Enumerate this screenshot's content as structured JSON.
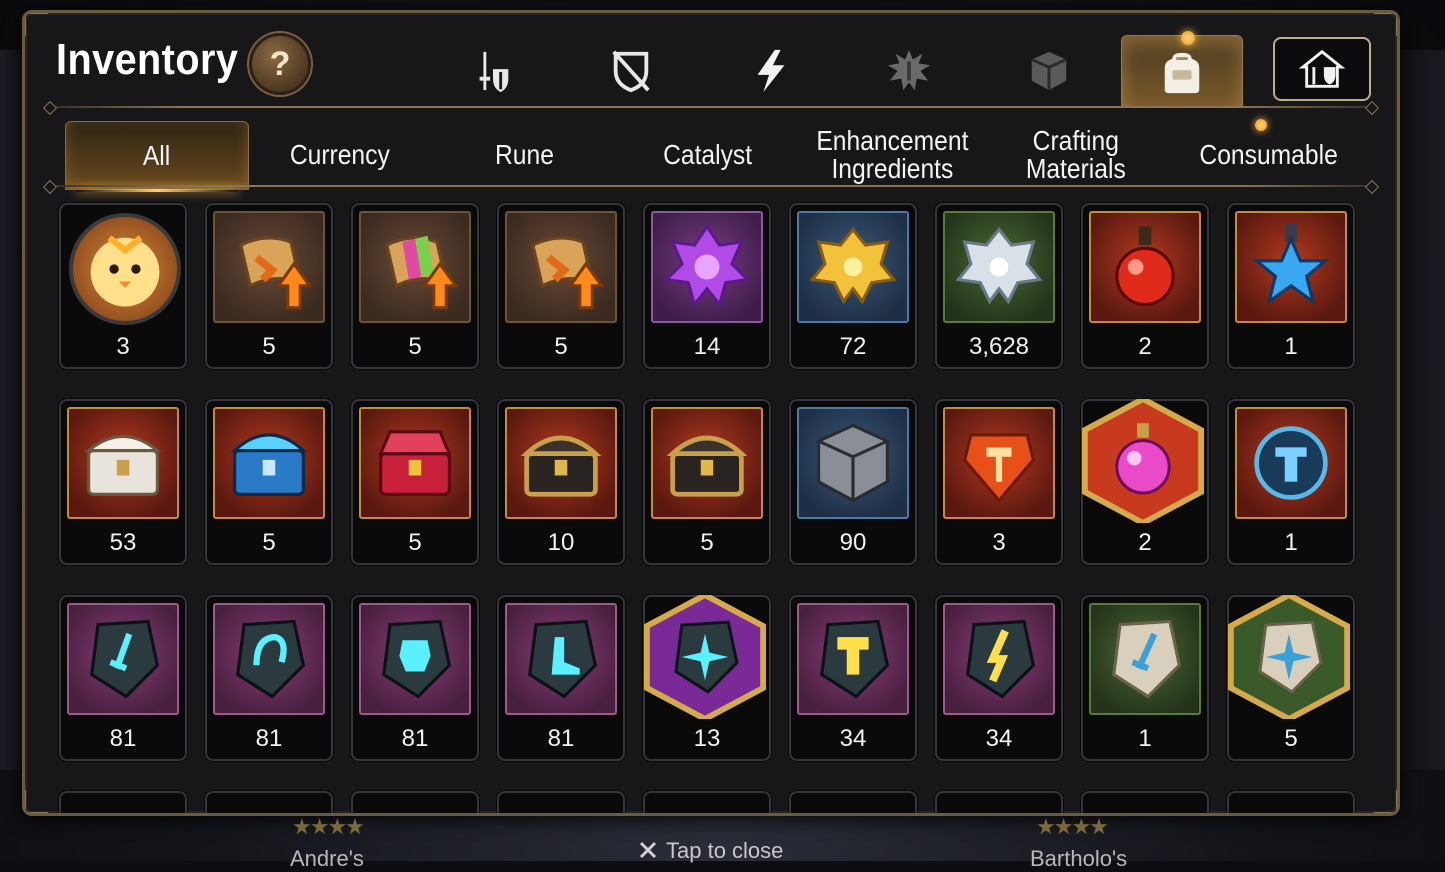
{
  "window": {
    "title": "Inventory",
    "help_label": "?"
  },
  "icon_tabs": [
    {
      "name": "equipment",
      "icon": "sword-shield-icon",
      "active": false
    },
    {
      "name": "artifact",
      "icon": "broken-shield-icon",
      "active": false
    },
    {
      "name": "skill",
      "icon": "lightning-icon",
      "active": false
    },
    {
      "name": "catalyst",
      "icon": "spiky-crest-icon",
      "active": false
    },
    {
      "name": "material",
      "icon": "cube-icon",
      "active": false
    },
    {
      "name": "items",
      "icon": "backpack-icon",
      "active": true,
      "notification": true
    },
    {
      "name": "storage",
      "icon": "house-shield-icon",
      "active": false
    }
  ],
  "filter_tabs": [
    {
      "label": "All",
      "active": true
    },
    {
      "label": "Currency",
      "active": false
    },
    {
      "label": "Rune",
      "active": false
    },
    {
      "label": "Catalyst",
      "active": false
    },
    {
      "label": "Enhancement\nIngredients",
      "active": false
    },
    {
      "label": "Crafting\nMaterials",
      "active": false
    },
    {
      "label": "Consumable",
      "active": false,
      "notification": true
    }
  ],
  "items": [
    {
      "count": "3",
      "icon": "chick-token-icon",
      "frame": "circle"
    },
    {
      "count": "5",
      "icon": "scroll-upgrade-icon",
      "frame": "brown"
    },
    {
      "count": "5",
      "icon": "rainbow-scroll-icon",
      "frame": "brown"
    },
    {
      "count": "5",
      "icon": "scroll-upgrade-icon",
      "frame": "brown"
    },
    {
      "count": "14",
      "icon": "purple-crystal-icon",
      "frame": "purple"
    },
    {
      "count": "72",
      "icon": "gold-crystal-icon",
      "frame": "blue"
    },
    {
      "count": "3,628",
      "icon": "silver-crystal-icon",
      "frame": "green"
    },
    {
      "count": "2",
      "icon": "red-potion-icon",
      "frame": "red"
    },
    {
      "count": "1",
      "icon": "blue-star-potion-icon",
      "frame": "red"
    },
    {
      "count": "53",
      "icon": "white-chest-icon",
      "frame": "red"
    },
    {
      "count": "5",
      "icon": "blue-chest-icon",
      "frame": "red"
    },
    {
      "count": "5",
      "icon": "red-chest-icon",
      "frame": "red"
    },
    {
      "count": "10",
      "icon": "black-gold-chest-icon",
      "frame": "red"
    },
    {
      "count": "5",
      "icon": "black-gold-chest-icon",
      "frame": "red"
    },
    {
      "count": "90",
      "icon": "steel-cube-icon",
      "frame": "blue"
    },
    {
      "count": "3",
      "icon": "hammer-gem-icon",
      "frame": "red"
    },
    {
      "count": "2",
      "icon": "pink-potion-icon",
      "frame": "hex-red"
    },
    {
      "count": "1",
      "icon": "reforge-hammer-icon",
      "frame": "red"
    },
    {
      "count": "81",
      "icon": "sword-stone-icon",
      "frame": "magenta"
    },
    {
      "count": "81",
      "icon": "helmet-stone-icon",
      "frame": "magenta"
    },
    {
      "count": "81",
      "icon": "armor-stone-icon",
      "frame": "magenta"
    },
    {
      "count": "81",
      "icon": "boots-stone-icon",
      "frame": "magenta"
    },
    {
      "count": "13",
      "icon": "star-stone-icon",
      "frame": "hex-purple"
    },
    {
      "count": "34",
      "icon": "hammer-stone-icon",
      "frame": "magenta"
    },
    {
      "count": "34",
      "icon": "bolt-stone-icon",
      "frame": "magenta"
    },
    {
      "count": "1",
      "icon": "pale-sword-stone-icon",
      "frame": "green"
    },
    {
      "count": "5",
      "icon": "pale-star-stone-icon",
      "frame": "hex-green"
    }
  ],
  "footer": {
    "close_label": "Tap to close",
    "left_name": "Andre's",
    "right_name": "Bartholo's"
  },
  "colors": {
    "panel_border": "#6a5a40",
    "accent_gold": "#ffb640",
    "slot_bg": "#0a0a0b"
  }
}
